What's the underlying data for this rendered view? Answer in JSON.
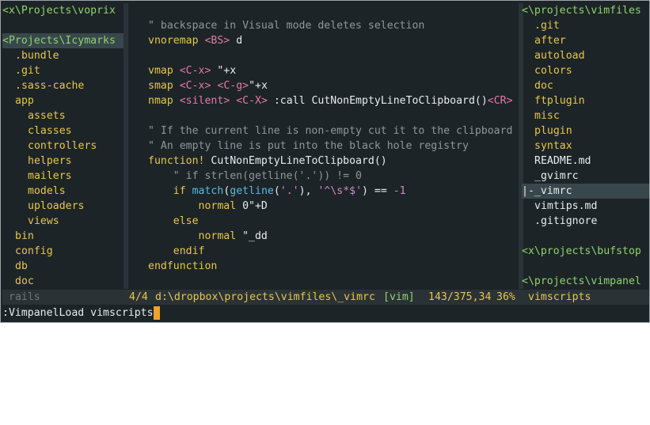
{
  "left_pane": {
    "lines": [
      {
        "text": "<x\\Projects\\voprix",
        "color": "#8fd36b",
        "indent": 0,
        "highlight": false
      },
      {
        "text": "",
        "color": "#8fd36b",
        "indent": 0,
        "highlight": false
      },
      {
        "text": "<Projects\\Icymarks",
        "color": "#8fd36b",
        "indent": 0,
        "highlight": true
      },
      {
        "text": ".bundle",
        "color": "#e5c74a",
        "indent": 1,
        "highlight": false
      },
      {
        "text": ".git",
        "color": "#e5c74a",
        "indent": 1,
        "highlight": false
      },
      {
        "text": ".sass-cache",
        "color": "#e5c74a",
        "indent": 1,
        "highlight": false
      },
      {
        "text": "app",
        "color": "#e5c74a",
        "indent": 1,
        "highlight": false
      },
      {
        "text": "assets",
        "color": "#e5c74a",
        "indent": 2,
        "highlight": false
      },
      {
        "text": "classes",
        "color": "#e5c74a",
        "indent": 2,
        "highlight": false
      },
      {
        "text": "controllers",
        "color": "#e5c74a",
        "indent": 2,
        "highlight": false
      },
      {
        "text": "helpers",
        "color": "#e5c74a",
        "indent": 2,
        "highlight": false
      },
      {
        "text": "mailers",
        "color": "#e5c74a",
        "indent": 2,
        "highlight": false
      },
      {
        "text": "models",
        "color": "#e5c74a",
        "indent": 2,
        "highlight": false
      },
      {
        "text": "uploaders",
        "color": "#e5c74a",
        "indent": 2,
        "highlight": false
      },
      {
        "text": "views",
        "color": "#e5c74a",
        "indent": 2,
        "highlight": false
      },
      {
        "text": "bin",
        "color": "#e5c74a",
        "indent": 1,
        "highlight": false
      },
      {
        "text": "config",
        "color": "#e5c74a",
        "indent": 1,
        "highlight": false
      },
      {
        "text": "db",
        "color": "#e5c74a",
        "indent": 1,
        "highlight": false
      },
      {
        "text": "doc",
        "color": "#e5c74a",
        "indent": 1,
        "highlight": false
      }
    ]
  },
  "editor": {
    "lines": [
      [],
      [
        {
          "t": "\" backspace in Visual mode deletes selection",
          "c": "#8d979b"
        }
      ],
      [
        {
          "t": "vnoremap",
          "c": "#e5c74a"
        },
        {
          "t": " ",
          "c": "#e8eceb"
        },
        {
          "t": "<BS>",
          "c": "#e678a6"
        },
        {
          "t": " d",
          "c": "#e8eceb"
        }
      ],
      [],
      [
        {
          "t": "vmap",
          "c": "#e5c74a"
        },
        {
          "t": " ",
          "c": "#e8eceb"
        },
        {
          "t": "<C-x>",
          "c": "#e678a6"
        },
        {
          "t": " \"+x",
          "c": "#e8eceb"
        }
      ],
      [
        {
          "t": "smap",
          "c": "#e5c74a"
        },
        {
          "t": " ",
          "c": "#e8eceb"
        },
        {
          "t": "<C-x>",
          "c": "#e678a6"
        },
        {
          "t": " ",
          "c": "#e8eceb"
        },
        {
          "t": "<C-g>",
          "c": "#e678a6"
        },
        {
          "t": "\"+x",
          "c": "#e8eceb"
        }
      ],
      [
        {
          "t": "nmap",
          "c": "#e5c74a"
        },
        {
          "t": " ",
          "c": "#e8eceb"
        },
        {
          "t": "<silent>",
          "c": "#e678a6"
        },
        {
          "t": " ",
          "c": "#e8eceb"
        },
        {
          "t": "<C-X>",
          "c": "#e678a6"
        },
        {
          "t": " :call CutNonEmptyLineToClipboard()",
          "c": "#e8eceb"
        },
        {
          "t": "<CR>",
          "c": "#e678a6"
        }
      ],
      [],
      [
        {
          "t": "\" If the current line is non-empty cut it to the clipboard",
          "c": "#8d979b"
        }
      ],
      [
        {
          "t": "\" An empty line is put into the black hole registry",
          "c": "#8d979b"
        }
      ],
      [
        {
          "t": "function!",
          "c": "#e5c74a"
        },
        {
          "t": " CutNonEmptyLineToClipboard()",
          "c": "#e8eceb"
        }
      ],
      [
        {
          "t": "    \" if strlen(getline('.')) != 0",
          "c": "#8d979b"
        }
      ],
      [
        {
          "t": "    ",
          "c": "#e8eceb"
        },
        {
          "t": "if",
          "c": "#e5c74a"
        },
        {
          "t": " ",
          "c": "#e8eceb"
        },
        {
          "t": "match",
          "c": "#5ab8e0"
        },
        {
          "t": "(",
          "c": "#e8eceb"
        },
        {
          "t": "getline",
          "c": "#5ab8e0"
        },
        {
          "t": "(",
          "c": "#e8eceb"
        },
        {
          "t": "'.'",
          "c": "#ca8cc6"
        },
        {
          "t": "), ",
          "c": "#e8eceb"
        },
        {
          "t": "'^\\s*$'",
          "c": "#ca8cc6"
        },
        {
          "t": ") == ",
          "c": "#e8eceb"
        },
        {
          "t": "-1",
          "c": "#ca8cc6"
        }
      ],
      [
        {
          "t": "        ",
          "c": "#e8eceb"
        },
        {
          "t": "normal",
          "c": "#e5c74a"
        },
        {
          "t": " 0\"+D",
          "c": "#e8eceb"
        }
      ],
      [
        {
          "t": "    ",
          "c": "#e8eceb"
        },
        {
          "t": "else",
          "c": "#e5c74a"
        }
      ],
      [
        {
          "t": "        ",
          "c": "#e8eceb"
        },
        {
          "t": "normal",
          "c": "#e5c74a"
        },
        {
          "t": " \"_dd",
          "c": "#e8eceb"
        }
      ],
      [
        {
          "t": "    ",
          "c": "#e8eceb"
        },
        {
          "t": "endif",
          "c": "#e5c74a"
        }
      ],
      [
        {
          "t": "endfunction",
          "c": "#e5c74a"
        }
      ],
      []
    ]
  },
  "right_pane": {
    "lines": [
      {
        "text": "<\\projects\\vimfiles",
        "color": "#8fd36b",
        "indent": 0,
        "highlight": false
      },
      {
        "text": ".git",
        "color": "#e5c74a",
        "indent": 1,
        "highlight": false
      },
      {
        "text": "after",
        "color": "#e5c74a",
        "indent": 1,
        "highlight": false
      },
      {
        "text": "autoload",
        "color": "#e5c74a",
        "indent": 1,
        "highlight": false
      },
      {
        "text": "colors",
        "color": "#e5c74a",
        "indent": 1,
        "highlight": false
      },
      {
        "text": "doc",
        "color": "#e5c74a",
        "indent": 1,
        "highlight": false
      },
      {
        "text": "ftplugin",
        "color": "#e5c74a",
        "indent": 1,
        "highlight": false
      },
      {
        "text": "misc",
        "color": "#e5c74a",
        "indent": 1,
        "highlight": false
      },
      {
        "text": "plugin",
        "color": "#e5c74a",
        "indent": 1,
        "highlight": false
      },
      {
        "text": "syntax",
        "color": "#e5c74a",
        "indent": 1,
        "highlight": false
      },
      {
        "text": "README.md",
        "color": "#e8eceb",
        "indent": 1,
        "highlight": false
      },
      {
        "text": "_gvimrc",
        "color": "#e8eceb",
        "indent": 1,
        "highlight": false
      },
      {
        "text": "|-_vimrc",
        "color": "#e8eceb",
        "indent": 0,
        "highlight": true
      },
      {
        "text": "vimtips.md",
        "color": "#e8eceb",
        "indent": 1,
        "highlight": false
      },
      {
        "text": ".gitignore",
        "color": "#e8eceb",
        "indent": 1,
        "highlight": false
      },
      {
        "text": "",
        "color": "#e8eceb",
        "indent": 0,
        "highlight": false
      },
      {
        "text": "<x\\projects\\bufstop",
        "color": "#8fd36b",
        "indent": 0,
        "highlight": false
      },
      {
        "text": "",
        "color": "#e8eceb",
        "indent": 0,
        "highlight": false
      },
      {
        "text": "<\\projects\\vimpanel",
        "color": "#8fd36b",
        "indent": 0,
        "highlight": false
      }
    ]
  },
  "statusbar": {
    "left_panel_name": "rails",
    "buffer_info": "4/4",
    "file_path": "d:\\dropbox\\projects\\vimfiles\\_vimrc",
    "filetype": "[vim]",
    "position": "143/375,34",
    "percent": "36%",
    "right_panel_name": "vimscripts"
  },
  "cmdline": {
    "text": ":VimpanelLoad vimscripts"
  },
  "colors": {
    "background": "#1d2428",
    "path": "#8fd36b",
    "directory": "#e5c74a",
    "file": "#e8eceb",
    "comment": "#8d979b",
    "cursor": "#f0a22a"
  }
}
